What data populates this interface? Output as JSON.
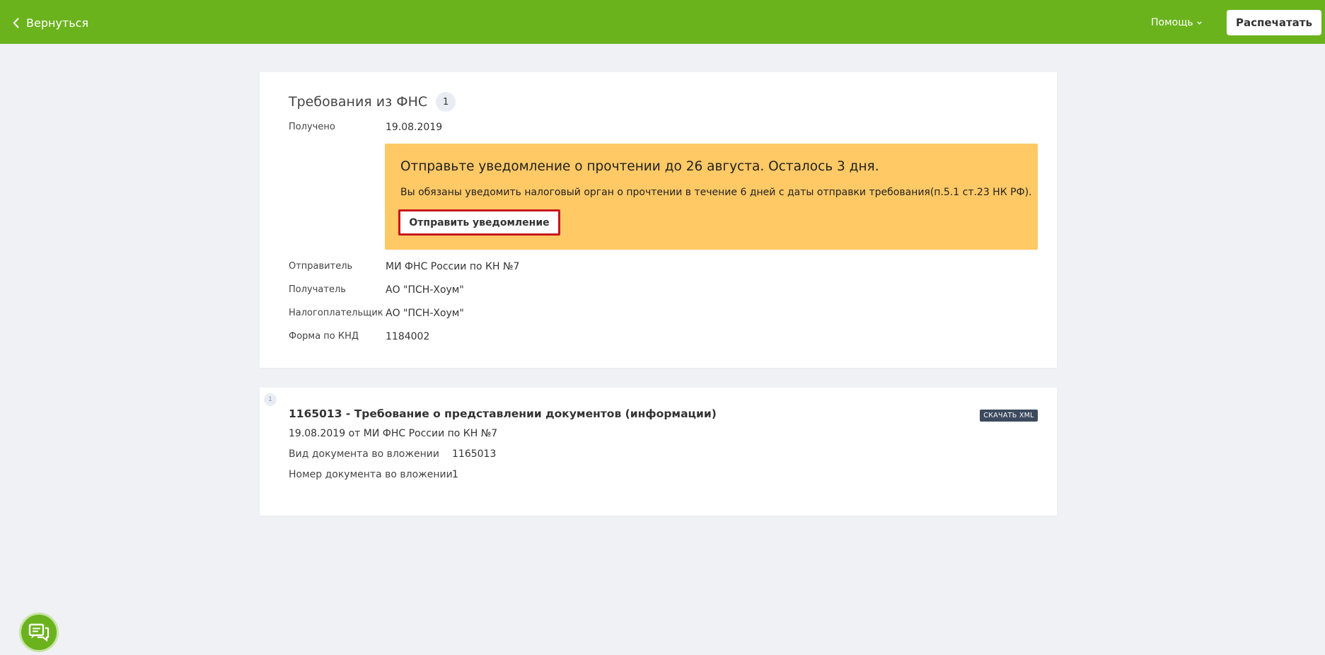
{
  "topbar": {
    "back_label": "Вернуться",
    "help_label": "Помощь",
    "print_label": "Распечатать",
    "color": "#6bb31d"
  },
  "requirements": {
    "title": "Требования из ФНС",
    "count": "1",
    "received_label": "Получено",
    "received_value": "19.08.2019",
    "alert": {
      "title": "Отправьте уведомление о прочтении до 26 августа. Осталось 3 дня.",
      "text": "Вы обязаны уведомить налоговый орган о прочтении в течение 6 дней с даты отправки требования(п.5.1 ст.23 НК РФ).",
      "button_label": "Отправить уведомление",
      "color": "#ffc966"
    },
    "fields": [
      {
        "label": "Отправитель",
        "value": "МИ ФНС России по КН №7"
      },
      {
        "label": "Получатель",
        "value": "АО \"ПСН-Хоум\""
      },
      {
        "label": "Налогоплательщик",
        "value": "АО \"ПСН-Хоум\""
      },
      {
        "label": "Форма по КНД",
        "value": "1184002"
      }
    ]
  },
  "document": {
    "index": "1",
    "title": "1165013 - Требование о представлении документов (информации)",
    "subtitle": "19.08.2019 от МИ ФНС России по КН №7",
    "download_label": "СКАЧАТЬ XML",
    "fields": [
      {
        "label": "Вид документа во вложении",
        "value": "1165013"
      },
      {
        "label": "Номер документа во вложении",
        "value": "1"
      }
    ]
  },
  "icons": {
    "back": "chevron-left-icon",
    "help": "chevron-down-icon",
    "chat": "chat-icon"
  }
}
